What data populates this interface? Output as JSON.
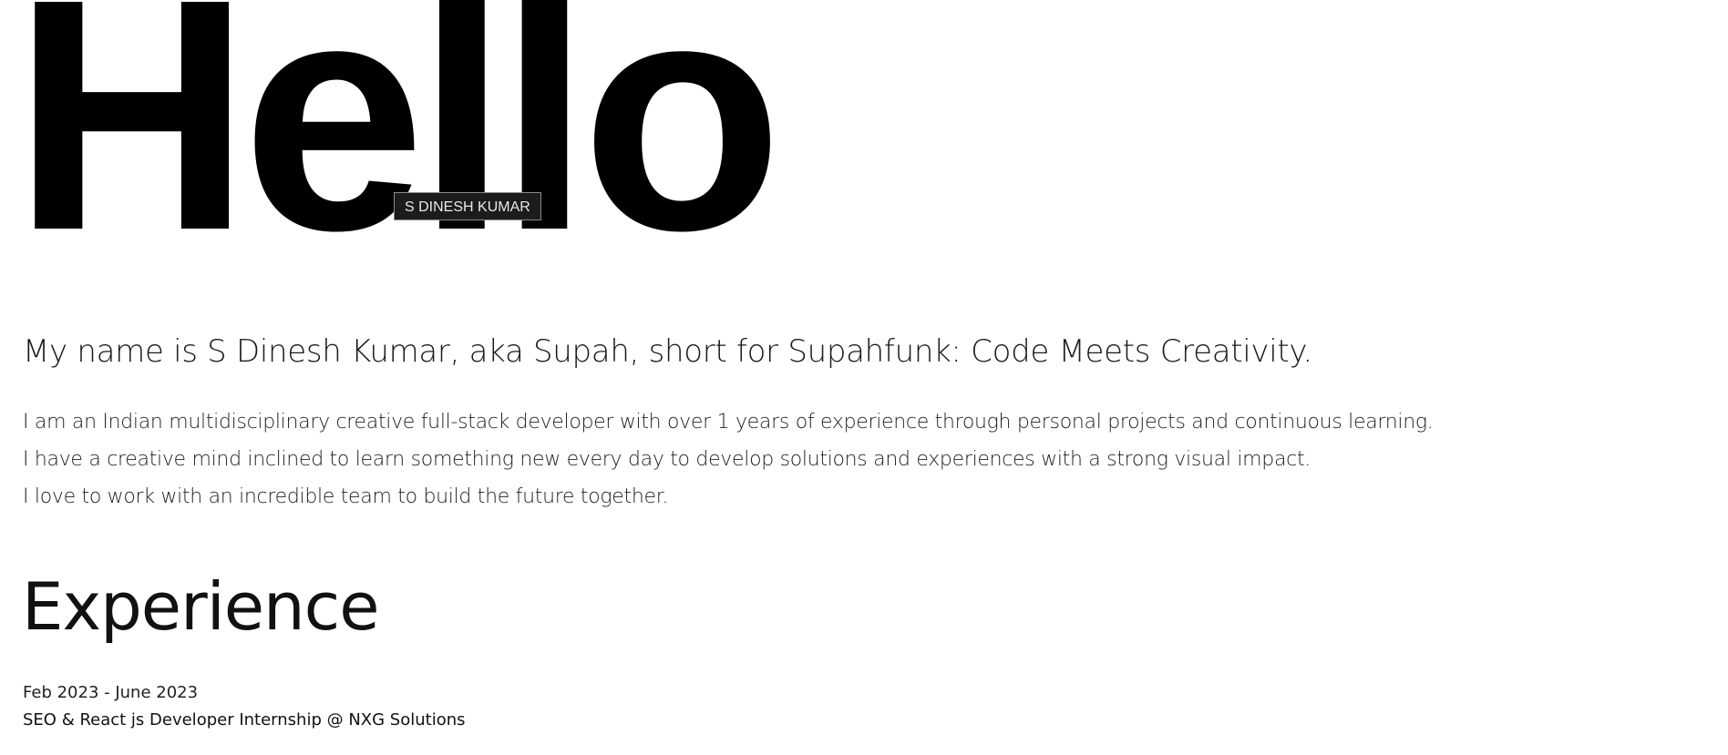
{
  "hero": {
    "title": "Hello",
    "tooltip": "S DINESH KUMAR"
  },
  "intro": {
    "heading": "My name is S Dinesh Kumar, aka Supah, short for Supahfunk: Code Meets Creativity.",
    "bio_lines": [
      "I am an Indian multidisciplinary creative full-stack developer with over 1 years of experience through personal projects and continuous learning.",
      "I have a creative mind inclined to learn something new every day to develop solutions and experiences with a strong visual impact.",
      "I love to work with an incredible team to build the future together."
    ]
  },
  "experience": {
    "heading": "Experience",
    "entries": [
      {
        "dates": "Feb 2023 - June 2023",
        "title": "SEO & React js Developer Internship @ NXG Solutions"
      }
    ]
  }
}
